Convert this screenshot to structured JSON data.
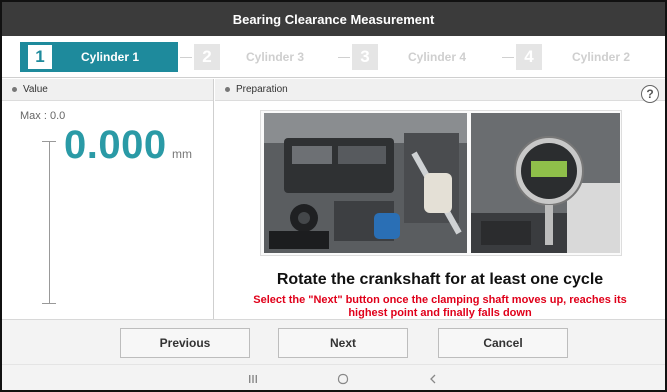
{
  "window": {
    "title": "Bearing Clearance Measurement"
  },
  "steps": [
    {
      "number": "1",
      "label": "Cylinder 1",
      "active": true
    },
    {
      "number": "2",
      "label": "Cylinder 3",
      "active": false
    },
    {
      "number": "3",
      "label": "Cylinder 4",
      "active": false
    },
    {
      "number": "4",
      "label": "Cylinder 2",
      "active": false
    }
  ],
  "value_panel": {
    "header": "Value",
    "max_text": "Max : 0.0",
    "reading": "0.000",
    "unit": "mm"
  },
  "preparation_panel": {
    "header": "Preparation",
    "help_label": "?",
    "instruction_title": "Rotate the crankshaft for at least one cycle",
    "instruction_detail": "Select the \"Next\" button once the clamping shaft moves up, reaches its highest point and finally falls down"
  },
  "buttons": {
    "previous": "Previous",
    "next": "Next",
    "cancel": "Cancel"
  },
  "android_nav": {
    "recents_icon": "recents-icon",
    "home_icon": "home-icon",
    "back_icon": "back-icon"
  },
  "colors": {
    "accent": "#1e8a9c",
    "reading": "#2a9aa6",
    "warning_text": "#e0001a",
    "title_bar": "#3b3b3b"
  }
}
